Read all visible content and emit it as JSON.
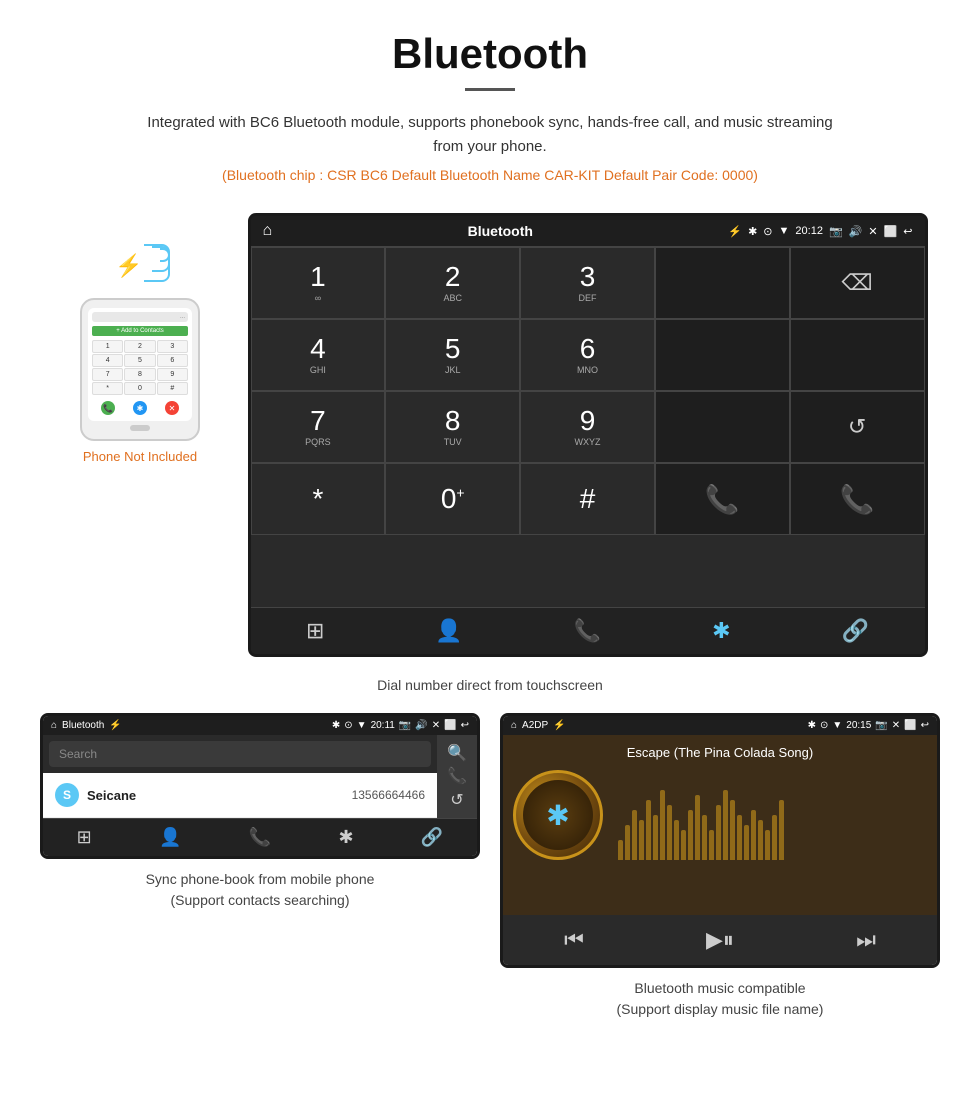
{
  "header": {
    "title": "Bluetooth",
    "description": "Integrated with BC6 Bluetooth module, supports phonebook sync, hands-free call, and music streaming from your phone.",
    "specs": "(Bluetooth chip : CSR BC6    Default Bluetooth Name CAR-KIT    Default Pair Code: 0000)"
  },
  "phone_area": {
    "not_included": "Phone Not Included"
  },
  "car_unit": {
    "statusbar": {
      "left": "⌂",
      "center": "Bluetooth",
      "usb": "⚡",
      "bt": "✱",
      "location": "⊙",
      "wifi": "▼",
      "time": "20:12",
      "camera": "📷",
      "volume": "🔊",
      "x": "✕",
      "rect": "⬜",
      "back": "↩"
    },
    "dialpad": {
      "keys": [
        {
          "num": "1",
          "sub": "∞"
        },
        {
          "num": "2",
          "sub": "ABC"
        },
        {
          "num": "3",
          "sub": "DEF"
        },
        {
          "num": "",
          "sub": ""
        },
        {
          "num": "⌫",
          "sub": ""
        },
        {
          "num": "4",
          "sub": "GHI"
        },
        {
          "num": "5",
          "sub": "JKL"
        },
        {
          "num": "6",
          "sub": "MNO"
        },
        {
          "num": "",
          "sub": ""
        },
        {
          "num": "",
          "sub": ""
        },
        {
          "num": "7",
          "sub": "PQRS"
        },
        {
          "num": "8",
          "sub": "TUV"
        },
        {
          "num": "9",
          "sub": "WXYZ"
        },
        {
          "num": "",
          "sub": ""
        },
        {
          "num": "↺",
          "sub": ""
        },
        {
          "num": "*",
          "sub": ""
        },
        {
          "num": "0+",
          "sub": ""
        },
        {
          "num": "#",
          "sub": ""
        },
        {
          "num": "📞",
          "sub": "green"
        },
        {
          "num": "📞",
          "sub": "red"
        }
      ]
    },
    "bottom_nav": [
      "⊞",
      "👤",
      "📞",
      "✱",
      "🔗"
    ]
  },
  "dial_caption": "Dial number direct from touchscreen",
  "phonebook_panel": {
    "statusbar_left": "⌂  Bluetooth  ⚡",
    "statusbar_right": "✱ ⊙ ▼ 20:11 📷 🔊 ✕ ⬜ ↩",
    "search_placeholder": "Search",
    "contact": {
      "letter": "S",
      "name": "Seicane",
      "number": "13566664466"
    },
    "bottom_nav": [
      "⊞",
      "👤",
      "📞",
      "✱",
      "🔗"
    ],
    "side_icons": [
      "🔍",
      "📞",
      "↺"
    ]
  },
  "phonebook_caption": {
    "line1": "Sync phone-book from mobile phone",
    "line2": "(Support contacts searching)"
  },
  "music_panel": {
    "statusbar_left": "⌂  A2DP  ⚡",
    "statusbar_right": "✱ ⊙ ▼ 20:15 📷 ✕ ⬜ ↩",
    "song_title": "Escape (The Pina Colada Song)",
    "controls": [
      "⏮",
      "▶⏸",
      "⏭"
    ],
    "viz_bars": [
      20,
      35,
      50,
      40,
      60,
      45,
      70,
      55,
      40,
      30,
      50,
      65,
      45,
      30,
      55,
      70,
      60,
      45,
      35,
      50,
      40,
      30,
      45,
      60
    ]
  },
  "music_caption": {
    "line1": "Bluetooth music compatible",
    "line2": "(Support display music file name)"
  }
}
